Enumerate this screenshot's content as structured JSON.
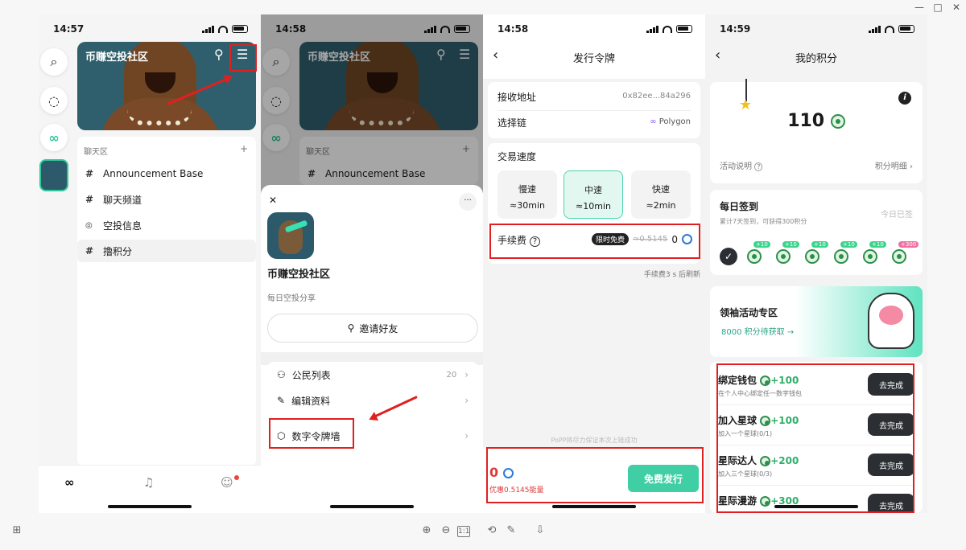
{
  "window": {
    "minimize": "—",
    "maximize": "□",
    "close": "✕"
  },
  "phone1": {
    "time": "14:57",
    "community_title": "币赚空投社区",
    "section_chat": "聊天区",
    "section_add": "+",
    "channels": [
      {
        "icon": "#",
        "label": "Announcement Base"
      },
      {
        "icon": "#",
        "label": "聊天频道"
      },
      {
        "icon": "◎",
        "label": "空投信息"
      },
      {
        "icon": "#",
        "label": "撸积分"
      }
    ]
  },
  "phone2": {
    "time": "14:58",
    "community_title": "币赚空投社区",
    "section_chat": "聊天区",
    "section_add": "+",
    "channel": "Announcement Base",
    "close": "✕",
    "more": "···",
    "name": "币赚空投社区",
    "desc": "每日空投分享",
    "invite": "邀请好友",
    "menu": [
      {
        "label": "公民列表",
        "count": "20"
      },
      {
        "label": "编辑资料",
        "count": ""
      },
      {
        "label": "数字令牌墙",
        "count": ""
      }
    ],
    "chevron": "›"
  },
  "phone3": {
    "time": "14:58",
    "back": "‹",
    "title": "发行令牌",
    "recv_label": "接收地址",
    "recv_value": "0x82ee...84a296",
    "chain_label": "选择链",
    "chain_value": "Polygon",
    "speed_title": "交易速度",
    "speeds": [
      {
        "name": "慢速",
        "time": "≈30min"
      },
      {
        "name": "中速",
        "time": "≈10min"
      },
      {
        "name": "快速",
        "time": "≈2min"
      }
    ],
    "fee_label": "手续费",
    "fee_badge": "限时免费",
    "fee_orig": "≈0.5145",
    "fee_value": "0",
    "refresh_note": "手续费3 s 后刷新",
    "guarantee_note": "PoPP将尽力保证本次上链成功",
    "total": "0",
    "discount": "优惠0.5145能量",
    "issue_btn": "免费发行"
  },
  "phone4": {
    "time": "14:59",
    "back": "‹",
    "title": "我的积分",
    "points": "110",
    "info_icon": "i",
    "activity_note": "活动说明",
    "detail_link": "积分明细",
    "checkin_title": "每日签到",
    "checkin_sub": "累计7天签到，可获得300积分",
    "checkin_status": "今日已签",
    "day_bonus": [
      "",
      "+10",
      "+10",
      "+10",
      "+10",
      "+10",
      "+300"
    ],
    "activity_title": "领袖活动专区",
    "activity_sub": "8000 积分待获取 →",
    "tasks": [
      {
        "title": "绑定钱包",
        "points": "+100",
        "sub": "在个人中心绑定任一数字钱包",
        "btn": "去完成"
      },
      {
        "title": "加入星球",
        "points": "+100",
        "sub": "加入一个星球(0/1)",
        "btn": "去完成"
      },
      {
        "title": "星际达人",
        "points": "+200",
        "sub": "加入三个星球(0/3)",
        "btn": "去完成"
      },
      {
        "title": "星际漫游",
        "points": "+300",
        "sub": "",
        "btn": "去完成"
      }
    ]
  },
  "toolbar": {
    "ratio": "1:1"
  }
}
